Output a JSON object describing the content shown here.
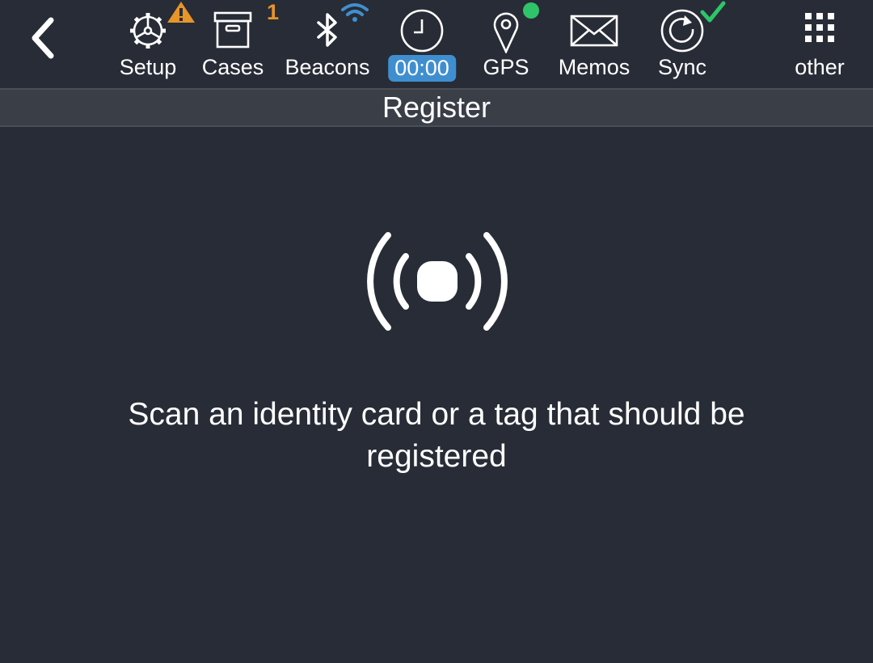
{
  "toolbar": {
    "back_icon": "chevron-left-icon",
    "items": [
      {
        "label": "Setup",
        "icon": "gear-icon",
        "status_icon": "warning-triangle-icon",
        "status_color": "#e6952a"
      },
      {
        "label": "Cases",
        "icon": "archive-box-icon",
        "badge": "1",
        "badge_color": "#e6952a"
      },
      {
        "label": "Beacons",
        "icon": "bluetooth-icon",
        "status_icon": "wifi-icon",
        "status_color": "#3f8fd0"
      },
      {
        "label": "00:00",
        "icon": "clock-icon",
        "label_bg": "#3f8fd0"
      },
      {
        "label": "GPS",
        "icon": "map-pin-icon",
        "status_icon": "status-dot-icon",
        "status_color": "#2ec56a"
      },
      {
        "label": "Memos",
        "icon": "envelope-icon"
      },
      {
        "label": "Sync",
        "icon": "sync-icon",
        "status_icon": "checkmark-icon",
        "status_color": "#2ec56a"
      },
      {
        "label": "other",
        "icon": "grid-dots-icon"
      }
    ]
  },
  "header": {
    "title": "Register"
  },
  "main": {
    "icon": "nfc-signal-icon",
    "message": "Scan an identity card or a tag that should be registered"
  },
  "colors": {
    "background": "#282c36",
    "title_bar": "#3a3e47",
    "accent_blue": "#3f8fd0",
    "warning_orange": "#e6952a",
    "ok_green": "#2ec56a"
  }
}
